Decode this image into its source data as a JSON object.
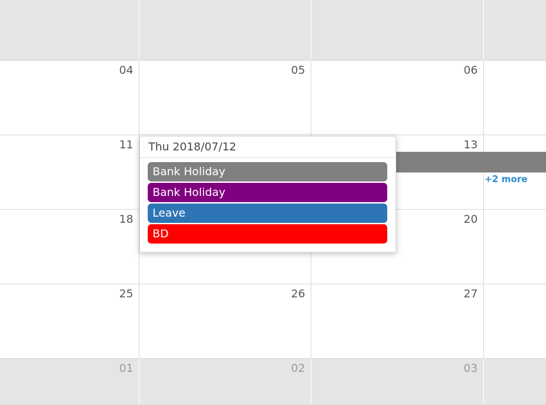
{
  "weeks": [
    {
      "style": "gray",
      "days": [
        "",
        "",
        "",
        ""
      ]
    },
    {
      "style": "normal",
      "days": [
        "04",
        "05",
        "06",
        ""
      ]
    },
    {
      "style": "normal",
      "days": [
        "11",
        "",
        "13",
        ""
      ]
    },
    {
      "style": "normal",
      "days": [
        "18",
        "",
        "20",
        ""
      ]
    },
    {
      "style": "normal",
      "days": [
        "25",
        "26",
        "27",
        ""
      ]
    },
    {
      "style": "gray-muted",
      "days": [
        "01",
        "02",
        "03",
        ""
      ]
    }
  ],
  "week_bar": {
    "color": "#808080"
  },
  "more_link": {
    "label": "+2 more",
    "color": "#2b8dd0"
  },
  "popover": {
    "title": "Thu 2018/07/12",
    "events": [
      {
        "label": "Bank Holiday",
        "color": "#808080"
      },
      {
        "label": "Bank Holiday",
        "color": "#800080"
      },
      {
        "label": "Leave",
        "color": "#2e75b6"
      },
      {
        "label": "BD",
        "color": "#ff0000"
      }
    ]
  }
}
